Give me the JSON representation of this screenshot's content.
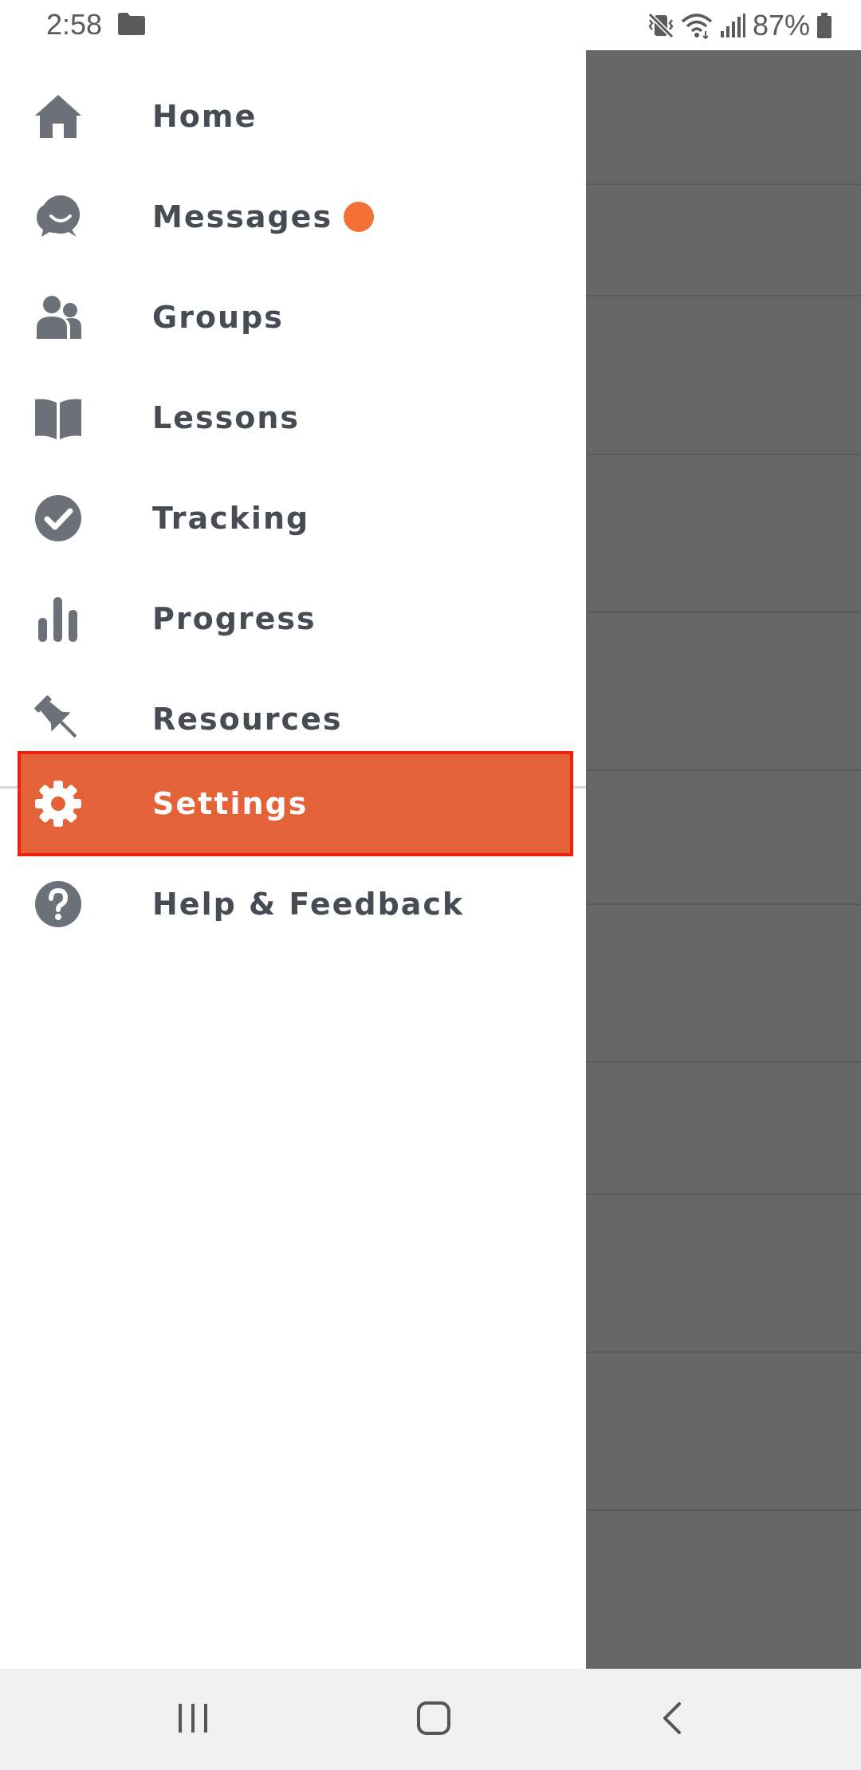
{
  "status_bar": {
    "time": "2:58",
    "battery": "87%",
    "icons": [
      "folder-icon",
      "mute-vibrate-icon",
      "wifi-icon",
      "signal-icon",
      "battery-icon"
    ]
  },
  "drawer": {
    "items": [
      {
        "label": "Home",
        "icon": "home-icon"
      },
      {
        "label": "Messages",
        "icon": "chat-bubbles-icon",
        "badge_color": "#f47136"
      },
      {
        "label": "Groups",
        "icon": "people-icon"
      },
      {
        "label": "Lessons",
        "icon": "open-book-icon"
      },
      {
        "label": "Tracking",
        "icon": "check-circle-icon"
      },
      {
        "label": "Progress",
        "icon": "bar-chart-icon"
      },
      {
        "label": "Resources",
        "icon": "pushpin-icon"
      }
    ],
    "secondary_items": [
      {
        "label": "Settings",
        "icon": "gear-icon",
        "selected": true
      },
      {
        "label": "Help & Feedback",
        "icon": "help-circle-icon"
      }
    ]
  },
  "colors": {
    "accent": "#e36237",
    "highlight_border": "#f21e0f",
    "badge": "#f47136",
    "icon": "#6c7078",
    "label": "#474b53",
    "scrim": "#666666"
  },
  "system_nav": {
    "buttons": [
      "recents-button",
      "home-button",
      "back-button"
    ]
  }
}
